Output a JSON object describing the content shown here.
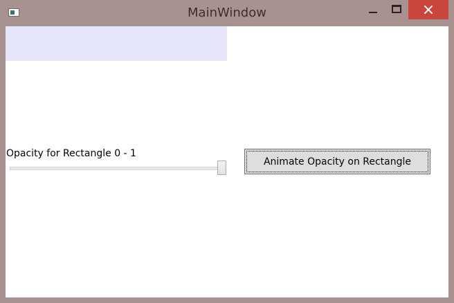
{
  "window": {
    "title": "MainWindow"
  },
  "colors": {
    "frame": "#a8928f",
    "rectangle_fill": "#e6e6fa",
    "close_button": "#c9463d"
  },
  "icons": {
    "app": "app-icon",
    "minimize": "minimize-icon",
    "maximize": "maximize-icon",
    "close": "close-icon"
  },
  "slider": {
    "label": "Opacity for Rectangle 0 - 1",
    "value": 1,
    "min": 0,
    "max": 1
  },
  "button": {
    "label": "Animate Opacity on Rectangle"
  }
}
